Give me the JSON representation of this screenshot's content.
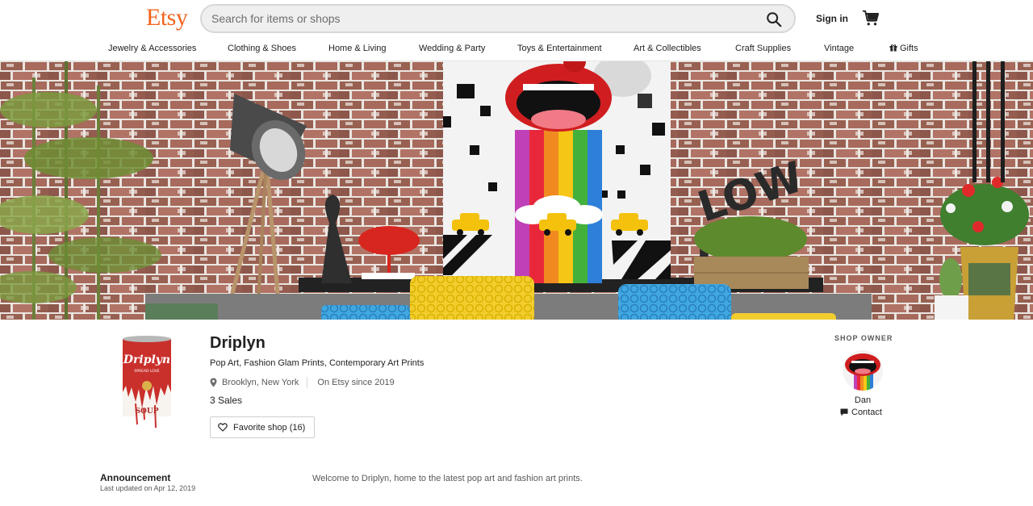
{
  "header": {
    "logo": "Etsy",
    "search_placeholder": "Search for items or shops",
    "signin_label": "Sign in",
    "colors": {
      "brand": "#F1641E"
    }
  },
  "nav": {
    "items": [
      "Jewelry & Accessories",
      "Clothing & Shoes",
      "Home & Living",
      "Wedding & Party",
      "Toys & Entertainment",
      "Art & Collectibles",
      "Craft Supplies",
      "Vintage",
      "Gifts"
    ]
  },
  "banner": {
    "sign_text": "LOW KEY"
  },
  "shop": {
    "logo_text": "Driplyn",
    "logo_subtext": "SPREAD LOVE",
    "logo_bottom_text": "SOUP",
    "name": "Driplyn",
    "title": "Pop Art, Fashion Glam Prints, Contemporary Art Prints",
    "location": "Brooklyn, New York",
    "since": "On Etsy since 2019",
    "sales": "3 Sales",
    "favorite_label": "Favorite shop (16)"
  },
  "owner": {
    "heading": "SHOP OWNER",
    "name": "Dan",
    "contact_label": "Contact"
  },
  "announcement": {
    "title": "Announcement",
    "updated": "Last updated on Apr 12, 2019",
    "text": "Welcome to Driplyn, home to the latest pop art and fashion art prints."
  }
}
